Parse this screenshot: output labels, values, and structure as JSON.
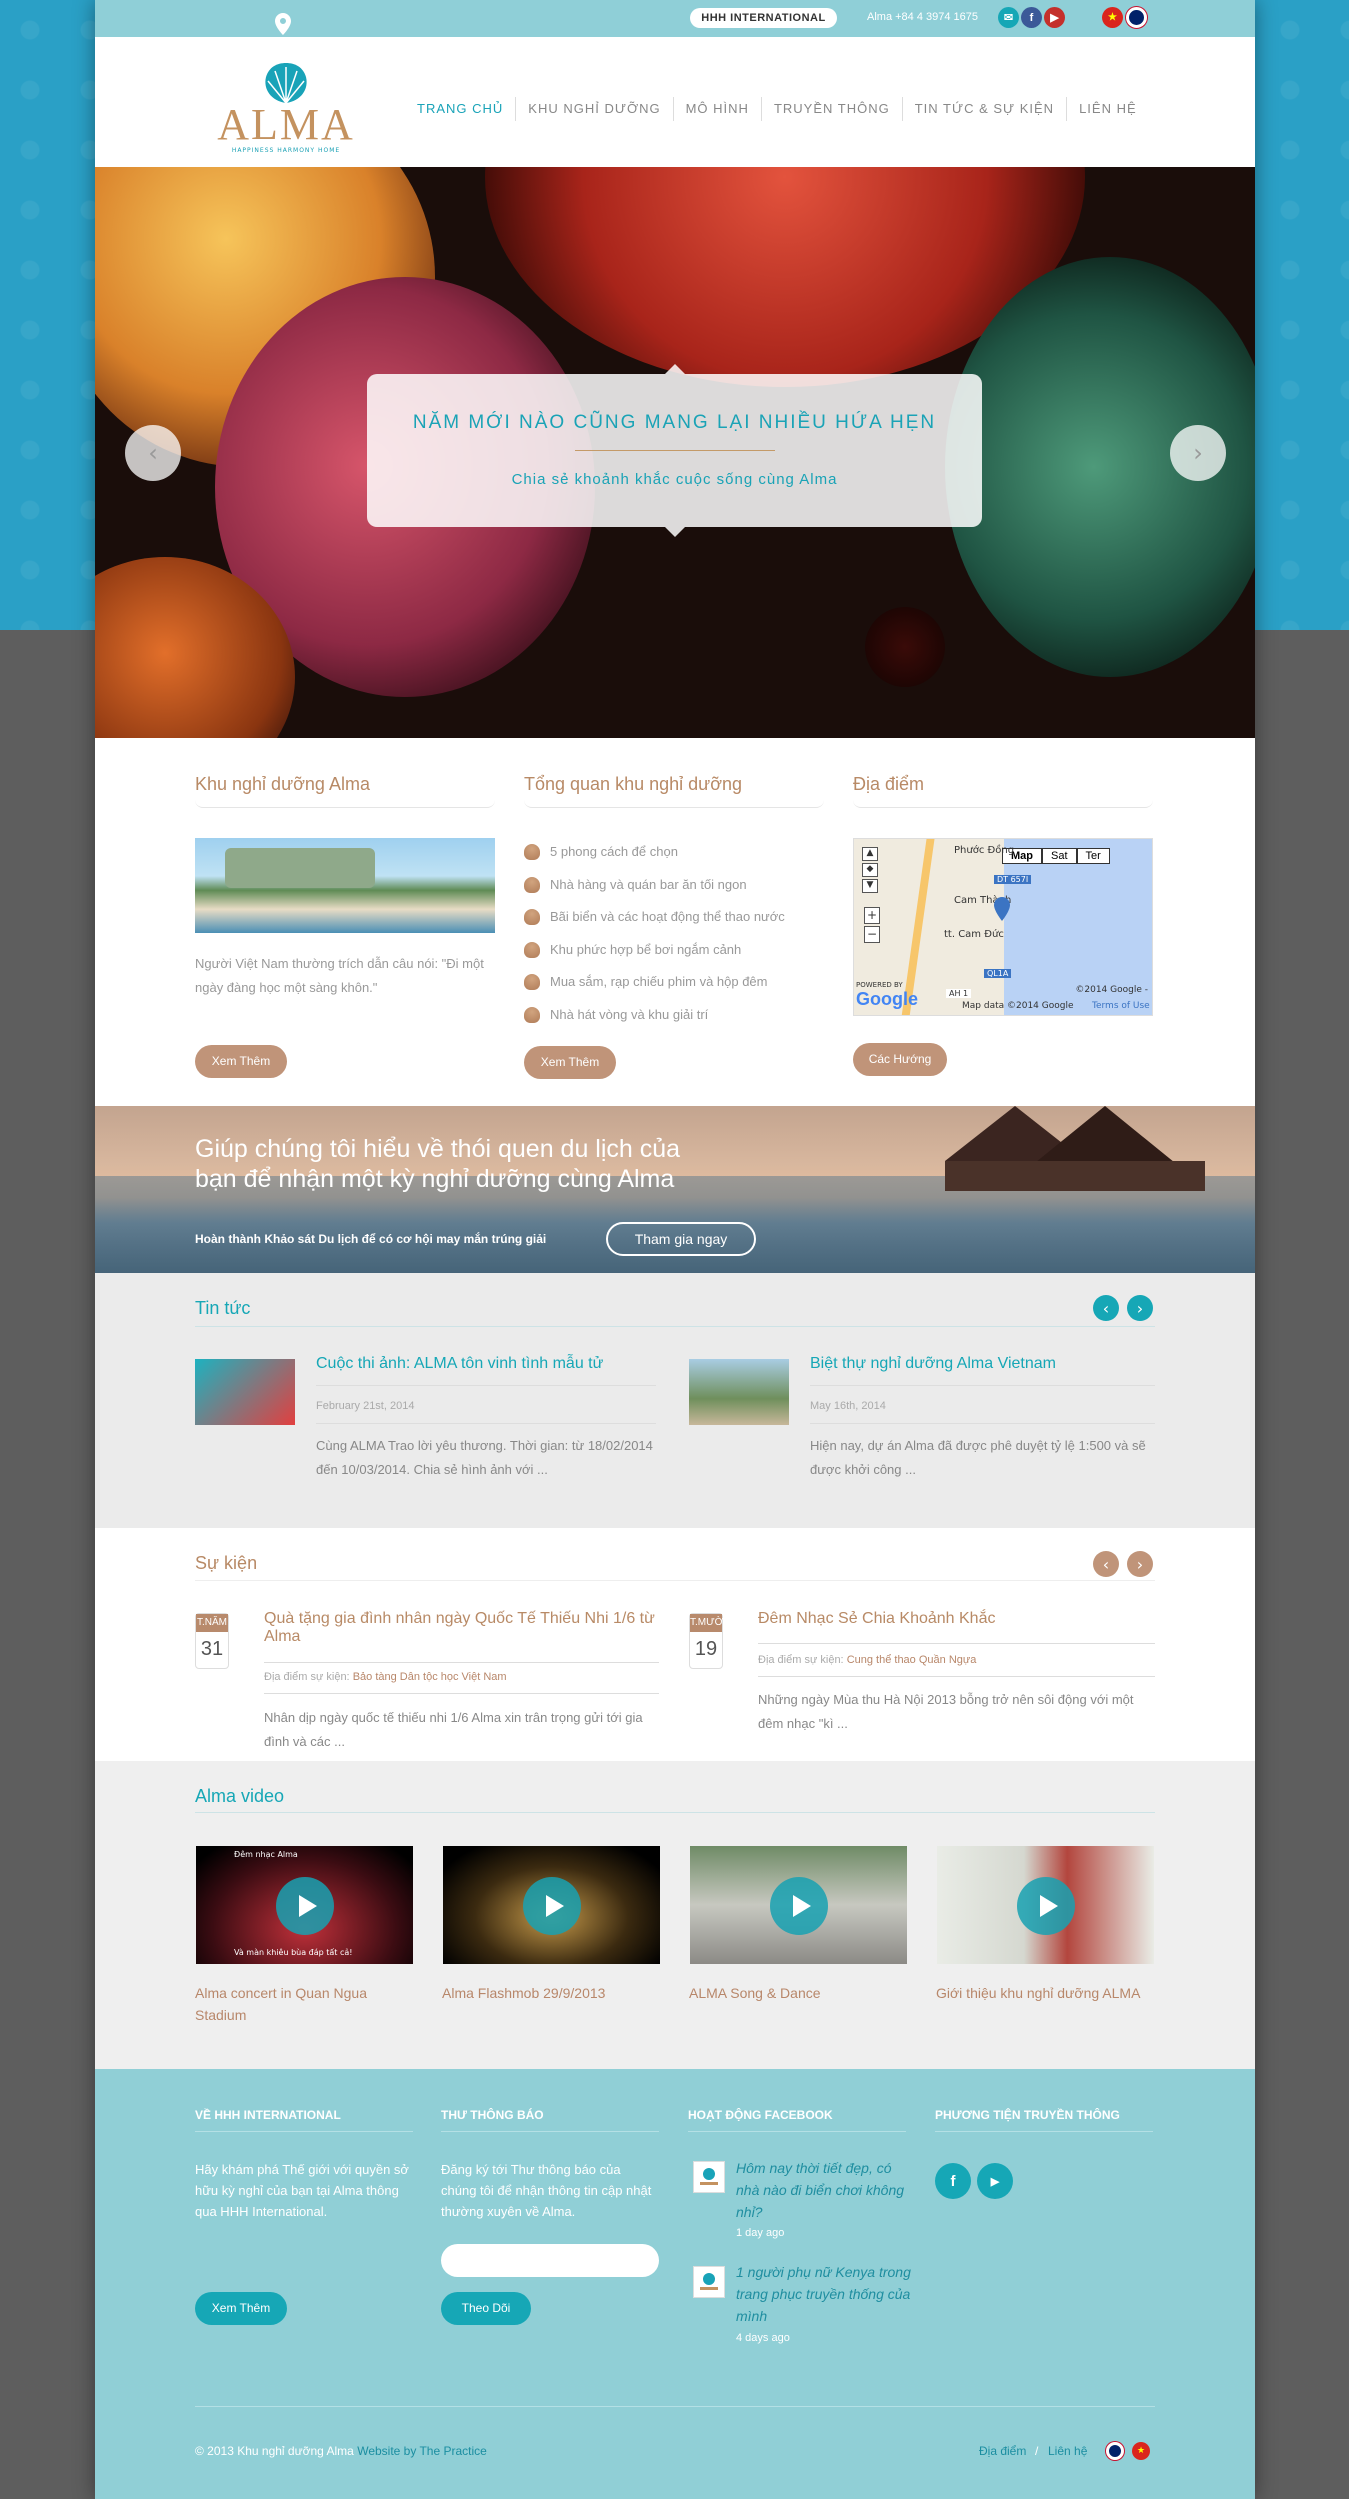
{
  "topbar": {
    "brand_badge": "HHH INTERNATIONAL",
    "phone": "Alma +84 4 3974 1675",
    "icons": [
      "mail-icon",
      "facebook-icon",
      "youtube-icon",
      "flag-vn-icon",
      "flag-uk-icon"
    ]
  },
  "logo": {
    "name": "ALMA",
    "tagline": "HAPPINESS HARMONY HOME"
  },
  "nav": {
    "items": [
      {
        "label": "TRANG CHỦ",
        "active": true
      },
      {
        "label": "KHU NGHỈ DƯỠNG",
        "active": false
      },
      {
        "label": "MÔ HÌNH",
        "active": false
      },
      {
        "label": "TRUYỀN THÔNG",
        "active": false
      },
      {
        "label": "TIN TỨC & SỰ KIỆN",
        "active": false
      },
      {
        "label": "LIÊN HỆ",
        "active": false
      }
    ]
  },
  "hero": {
    "title": "NĂM MỚI NÀO CŨNG MANG LẠI NHIỀU HỨA HẸN",
    "subtitle": "Chia sẻ khoảnh khắc cuộc sống cùng Alma"
  },
  "columns": {
    "resort": {
      "title": "Khu nghỉ dưỡng Alma",
      "text": "Người Việt Nam thường trích dẫn câu nói: \"Đi một ngày đàng học một sàng khôn.\"",
      "button": "Xem Thêm"
    },
    "overview": {
      "title": "Tổng quan khu nghỉ dưỡng",
      "items": [
        "5 phong cách để chọn",
        "Nhà hàng và quán bar ăn tối ngon",
        "Bãi biển và các hoạt động thể thao nước",
        "Khu phức hợp bể bơi ngắm cảnh",
        "Mua sắm, rạp chiếu phim và hộp đêm",
        "Nhà hát vòng và khu giải trí"
      ],
      "button": "Xem Thêm"
    },
    "location": {
      "title": "Địa điểm",
      "map_buttons": [
        "Map",
        "Sat",
        "Ter"
      ],
      "map_labels": [
        "Phước Đồng",
        "DT 657I",
        "Cam Thành",
        "tt. Cam Đức",
        "QL1A",
        "AH 1"
      ],
      "map_credit": "Map data ©2014 Google",
      "map_terms": "Terms of Use",
      "map_copyright": "©2014 Google -",
      "map_powered": "POWERED BY",
      "map_brand": "Google",
      "button": "Các Hướng"
    }
  },
  "banner": {
    "title": "Giúp chúng tôi hiểu về thói quen du lịch của bạn để nhận một kỳ nghỉ dưỡng cùng Alma",
    "subtitle": "Hoàn thành Khảo sát Du lịch để có cơ hội may mắn trúng giải",
    "button": "Tham gia ngay"
  },
  "news": {
    "title": "Tin tức",
    "items": [
      {
        "title": "Cuộc thi ảnh: ALMA tôn vinh tình mẫu tử",
        "date": "February 21st, 2014",
        "excerpt": "Cùng ALMA Trao lời yêu thương. Thời gian: từ 18/02/2014 đến 10/03/2014. Chia sẻ hình ảnh với ..."
      },
      {
        "title": "Biệt thự nghỉ dưỡng Alma Vietnam",
        "date": "May 16th, 2014",
        "excerpt": "Hiện nay, dự án Alma đã được phê duyệt tỷ lệ 1:500 và sẽ được khởi công ..."
      }
    ]
  },
  "events": {
    "title": "Sự kiện",
    "location_label": "Địa điểm sự kiện:",
    "items": [
      {
        "month": "T.NĂM",
        "day": "31",
        "title": "Quà tặng gia đình nhân ngày Quốc Tế Thiếu Nhi 1/6 từ Alma",
        "location": "Bảo tàng Dân tộc học Việt Nam",
        "excerpt": "Nhân dịp ngày quốc tế thiếu nhi 1/6 Alma xin trân trọng gửi tới gia đình và các ..."
      },
      {
        "month": "T.MƯỜI",
        "day": "19",
        "title": "Đêm Nhạc Sẻ Chia Khoảnh Khắc",
        "location": "Cung thể thao Quần Ngựa",
        "excerpt": "Những ngày Mùa thu Hà Nội 2013 bỗng trở nên sôi động với một đêm nhạc \"kì ..."
      }
    ]
  },
  "videos": {
    "title": "Alma video",
    "items": [
      {
        "caption": "Alma concert in Quan Ngua Stadium",
        "overlay_top": "Đêm nhạc Alma",
        "overlay_bottom": "Và màn khiêu bùa đáp tất cả!"
      },
      {
        "caption": "Alma Flashmob 29/9/2013"
      },
      {
        "caption": "ALMA Song & Dance"
      },
      {
        "caption": "Giới thiệu khu nghỉ dưỡng ALMA"
      }
    ]
  },
  "footer": {
    "about": {
      "title": "VỀ HHH INTERNATIONAL",
      "text": "Hãy khám phá Thế giới với quyền sở hữu kỳ nghỉ của bạn tại Alma thông qua HHH International.",
      "button": "Xem Thêm"
    },
    "newsletter": {
      "title": "THƯ THÔNG BÁO",
      "text": "Đăng ký tới Thư thông báo của chúng tôi để nhận thông tin cập nhật thường xuyên về Alma.",
      "input_placeholder": "",
      "button": "Theo Dõi"
    },
    "facebook": {
      "title": "HOẠT ĐỘNG FACEBOOK",
      "posts": [
        {
          "text": "Hôm nay thời tiết đẹp, có nhà nào đi biển chơi không nhỉ?",
          "time": "1 day ago"
        },
        {
          "text": "1 người phụ nữ Kenya trong trang phục truyền thống của mình",
          "time": "4 days ago"
        }
      ]
    },
    "social": {
      "title": "PHƯƠNG TIỆN TRUYỀN THÔNG",
      "icons": [
        "facebook-icon",
        "youtube-icon"
      ]
    },
    "copyright": "© 2013 Khu nghỉ dưỡng Alma",
    "credit": "Website by The Practice",
    "links": [
      "Địa điểm",
      "/",
      "Liên hệ"
    ]
  },
  "colors": {
    "teal": "#16a7b6",
    "brown": "#c09479",
    "footer": "#90cfd6",
    "gold": "#b88a66"
  }
}
